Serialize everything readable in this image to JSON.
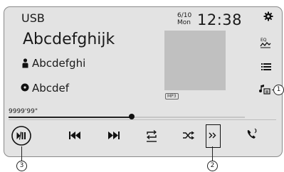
{
  "header": {
    "source": "USB",
    "date": "6/10",
    "day": "Mon",
    "time": "12:38"
  },
  "track": {
    "title": "Abcdefghijk",
    "artist": "Abcdefghi",
    "album": "Abcdef",
    "format_badge": "MP3",
    "play_time": "9999'99\"",
    "progress_fraction": 0.52
  },
  "side_icons": [
    "gear-icon",
    "eq-icon",
    "list-icon",
    "music-search-icon"
  ],
  "transport": [
    "play-pause-icon",
    "previous-track-icon",
    "next-track-icon",
    "repeat-icon",
    "shuffle-icon",
    "more-icon",
    "phone-icon"
  ],
  "callouts": {
    "c1": "1",
    "c2": "2",
    "c3": "3"
  }
}
